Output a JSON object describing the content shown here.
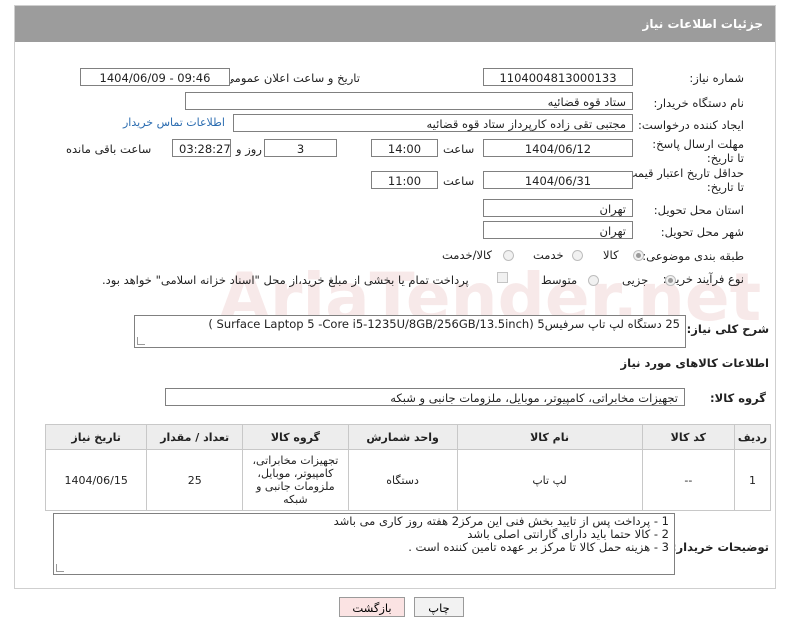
{
  "header": {
    "title": "جزئیات اطلاعات نیاز"
  },
  "fields": {
    "need_number_label": "شماره نیاز:",
    "need_number": "1104004813000133",
    "announce_label": "تاریخ و ساعت اعلان عمومی:",
    "announce_value": "1404/06/09 - 09:46",
    "buyer_org_label": "نام دستگاه خریدار:",
    "buyer_org": "ستاد قوه قضائیه",
    "creator_label": "ایجاد کننده درخواست:",
    "creator": "مجتبی تقی زاده کارپرداز ستاد قوه قضائیه",
    "contact_link": "اطلاعات تماس خریدار",
    "deadline_label": "مهلت ارسال پاسخ: تا تاریخ:",
    "deadline_date": "1404/06/12",
    "time_label": "ساعت",
    "deadline_time": "14:00",
    "days_value": "3",
    "days_label": "روز و",
    "remaining_time": "03:28:27",
    "remaining_label": "ساعت باقی مانده",
    "validity_label": "حداقل تاریخ اعتبار قیمت: تا تاریخ:",
    "validity_date": "1404/06/31",
    "validity_time": "11:00",
    "province_label": "استان محل تحویل:",
    "province": "تهران",
    "city_label": "شهر محل تحویل:",
    "city": "تهران",
    "category_label": "طبقه بندی موضوعی:",
    "category_options": [
      "کالا",
      "خدمت",
      "کالا/خدمت"
    ],
    "process_label": "نوع فرآیند خرید :",
    "process_options": [
      "جزیی",
      "متوسط"
    ],
    "payment_note": "پرداخت تمام یا بخشی از مبلغ خرید،از محل \"اسناد خزانه اسلامی\" خواهد بود.",
    "description_label": "شرح کلی نیاز:",
    "description": "25 دستگاه لپ تاپ سرفیس5 (Surface Laptop 5 -Core i5-1235U/8GB/256GB/13.5inch )",
    "goods_info_title": "اطلاعات کالاهای مورد نیاز",
    "goods_group_label": "گروه کالا:",
    "goods_group": "تجهیزات مخابراتی، کامپیوتر، موبایل، ملزومات جانبی و شبکه",
    "buyer_notes_label": "توضیحات خریدار:",
    "buyer_notes": [
      "1 - پرداخت پس از تایید بخش فنی این مرکز2 هفته روز کاری می باشد",
      "2 - کالا حتما باید دارای گارانتی اصلی باشد",
      "3 - هزینه حمل کالا تا مرکز بر عهده تامین کننده است ."
    ]
  },
  "table": {
    "headers": [
      "ردیف",
      "کد کالا",
      "نام کالا",
      "واحد شمارش",
      "گروه کالا",
      "تعداد / مقدار",
      "تاریخ نیاز"
    ],
    "rows": [
      [
        "1",
        "--",
        "لپ تاپ",
        "دستگاه",
        "تجهیزات مخابراتی، کامپیوتر، موبایل، ملزومات جانبی و شبکه",
        "25",
        "1404/06/15"
      ]
    ]
  },
  "buttons": {
    "print": "چاپ",
    "back": "بازگشت"
  },
  "watermark": "AriaTender.net",
  "colors": {
    "header_bg": "#9c9c9c",
    "back_button_bg": "#fbe3e3",
    "link": "#2b6cb0"
  }
}
